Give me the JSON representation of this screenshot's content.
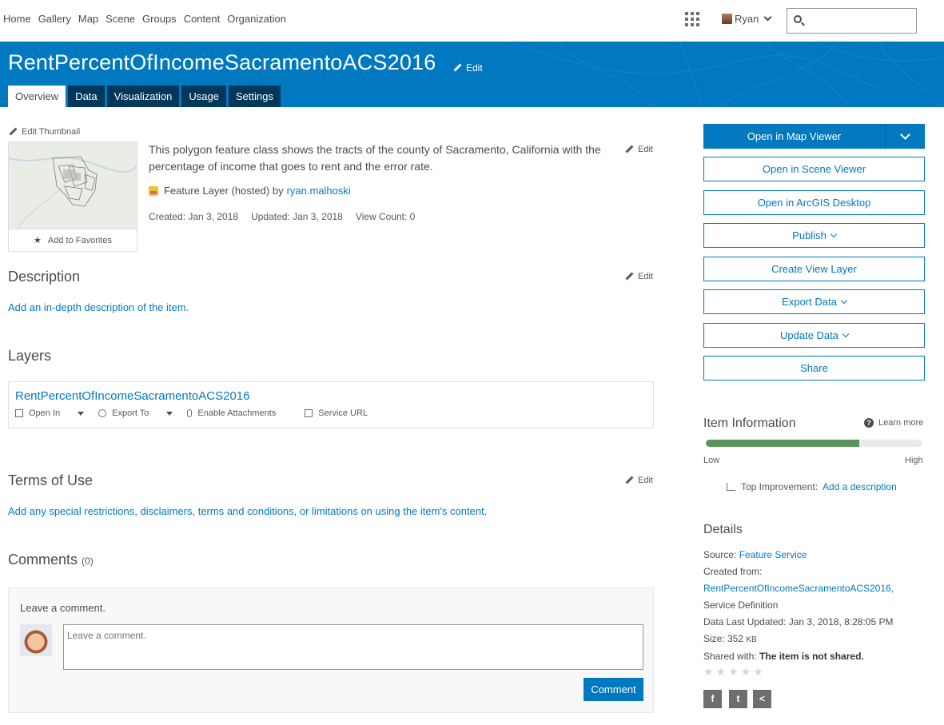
{
  "nav": {
    "links": [
      "Home",
      "Gallery",
      "Map",
      "Scene",
      "Groups",
      "Content",
      "Organization"
    ],
    "user": "Ryan",
    "search_placeholder": ""
  },
  "banner": {
    "title": "RentPercentOfIncomeSacramentoACS2016",
    "edit_label": "Edit",
    "tabs": [
      {
        "label": "Overview",
        "active": true
      },
      {
        "label": "Data",
        "active": false
      },
      {
        "label": "Visualization",
        "active": false
      },
      {
        "label": "Usage",
        "active": false
      },
      {
        "label": "Settings",
        "active": false
      }
    ]
  },
  "overview": {
    "edit_thumbnail": "Edit Thumbnail",
    "add_to_favorites": "Add to Favorites",
    "snippet": "This polygon feature class shows the tracts of the county of Sacramento, California with the percentage of income that goes to rent and the error rate.",
    "edit_label": "Edit",
    "layer_type": "Feature Layer (hosted) by",
    "owner": "ryan.malhoski",
    "created": "Created: Jan 3, 2018",
    "updated": "Updated: Jan 3, 2018",
    "view_count": "View Count: 0"
  },
  "description": {
    "heading": "Description",
    "edit_label": "Edit",
    "link": "Add an in-depth description of the item."
  },
  "layers": {
    "heading": "Layers",
    "layer_name": "RentPercentOfIncomeSacramentoACS2016",
    "actions": [
      "Open In",
      "Export To",
      "Enable Attachments",
      "Service URL"
    ]
  },
  "terms": {
    "heading": "Terms of Use",
    "edit_label": "Edit",
    "link": "Add any special restrictions, disclaimers, terms and conditions, or limitations on using the item's content."
  },
  "comments": {
    "heading": "Comments",
    "count": "(0)",
    "label": "Leave a comment.",
    "placeholder": "Leave a comment.",
    "button": "Comment"
  },
  "actions": {
    "open_map_viewer": "Open in Map Viewer",
    "open_scene_viewer": "Open in Scene Viewer",
    "open_desktop": "Open in ArcGIS Desktop",
    "publish": "Publish",
    "create_view_layer": "Create View Layer",
    "export_data": "Export Data",
    "update_data": "Update Data",
    "share": "Share"
  },
  "item_info": {
    "heading": "Item Information",
    "learn_more": "Learn more",
    "progress": 0.71,
    "progress_color": "#5a9359",
    "low": "Low",
    "high": "High",
    "top_improvement_label": "Top Improvement:",
    "top_improvement_link": "Add a description"
  },
  "details": {
    "heading": "Details",
    "source_label": "Source:",
    "source_value": "Feature Service",
    "created_from_label": "Created from:",
    "created_from_value": "RentPercentOfIncomeSacramentoACS2016,",
    "created_from_type": "Service Definition",
    "data_updated": "Data Last Updated: Jan 3, 2018, 8:28:05 PM",
    "size_label": "Size: 352",
    "size_unit": "KB",
    "shared_label": "Shared with:",
    "shared_value": "The item is not shared.",
    "rating_stars": "★★★★★"
  },
  "social": [
    "facebook-icon",
    "twitter-icon",
    "share-icon"
  ],
  "colors": {
    "accent": "#0079c1",
    "tab_dark": "#00375a"
  }
}
